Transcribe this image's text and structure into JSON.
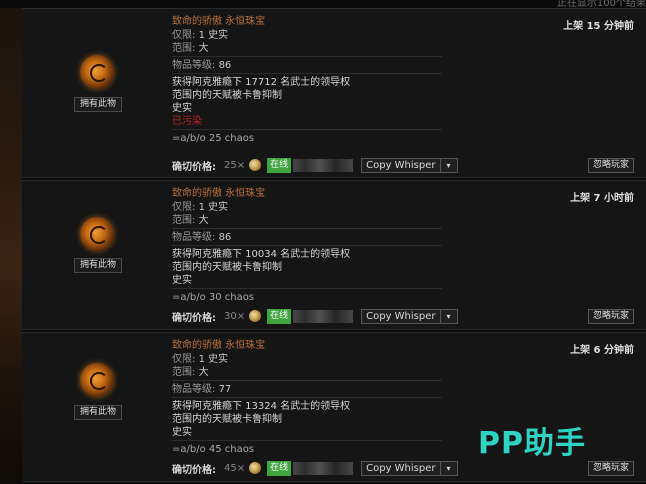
{
  "top_note": "正在显示100个结果",
  "listings": [
    {
      "item_name": "致命的骄傲 永恒珠宝",
      "props": [
        {
          "key": "仅限",
          "value": "1 史实"
        },
        {
          "key": "范围",
          "value": "大"
        }
      ],
      "item_level_label": "物品等级",
      "item_level": "86",
      "mods": [
        "获得阿克雅瘾下 17712 名武士的领导权",
        "范围内的天赋被卡鲁抑制",
        "史实"
      ],
      "corrupted": "已污染",
      "note": "=a/b/o 25 chaos",
      "listed": "上架 15 分钟前",
      "owned_label": "拥有此物",
      "price_label": "确切价格:",
      "price_amount": "25×",
      "online": "在线",
      "whisper": "Copy Whisper",
      "dropdown": "▾",
      "ignore": "忽略玩家"
    },
    {
      "item_name": "致命的骄傲 永恒珠宝",
      "props": [
        {
          "key": "仅限",
          "value": "1 史实"
        },
        {
          "key": "范围",
          "value": "大"
        }
      ],
      "item_level_label": "物品等级",
      "item_level": "86",
      "mods": [
        "获得阿克雅瘾下 10034 名武士的领导权",
        "范围内的天赋被卡鲁抑制",
        "史实"
      ],
      "note": "=a/b/o 30 chaos",
      "listed": "上架 7 小时前",
      "owned_label": "拥有此物",
      "price_label": "确切价格:",
      "price_amount": "30×",
      "online": "在线",
      "whisper": "Copy Whisper",
      "dropdown": "▾",
      "ignore": "忽略玩家"
    },
    {
      "item_name": "致命的骄傲 永恒珠宝",
      "props": [
        {
          "key": "仅限",
          "value": "1 史实"
        },
        {
          "key": "范围",
          "value": "大"
        }
      ],
      "item_level_label": "物品等级",
      "item_level": "77",
      "mods": [
        "获得阿克雅瘾下 13324 名武士的领导权",
        "范围内的天赋被卡鲁抑制",
        "史实"
      ],
      "note": "=a/b/o 45 chaos",
      "listed": "上架 6 分钟前",
      "owned_label": "拥有此物",
      "price_label": "确切价格:",
      "price_amount": "45×",
      "online": "在线",
      "whisper": "Copy Whisper",
      "dropdown": "▾",
      "ignore": "忽略玩家"
    }
  ],
  "watermark": "PP助手",
  "colors": {
    "item_name": "#b8703a",
    "corrupted": "#c42020",
    "online": "#3ea43e",
    "watermark": "#2fd3c4"
  },
  "icons": {
    "item": "jewel-icon",
    "currency": "chaos-orb-icon"
  }
}
